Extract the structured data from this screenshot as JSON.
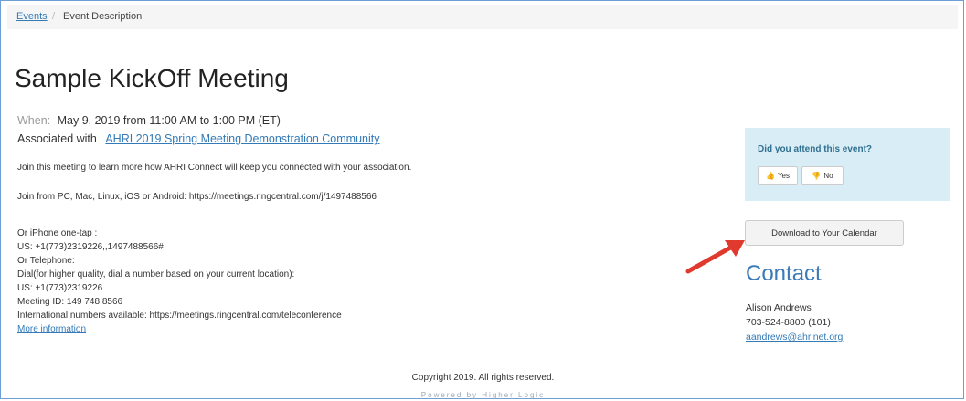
{
  "breadcrumb": {
    "link": "Events",
    "separator": "/",
    "current": "Event Description"
  },
  "event": {
    "title": "Sample KickOff Meeting",
    "when_label": "When:",
    "when_value": "May 9, 2019 from 11:00 AM to 1:00 PM (ET)",
    "assoc_label": "Associated with",
    "assoc_link": "AHRI 2019 Spring Meeting Demonstration Community",
    "description": [
      "Join this meeting to learn more how AHRI Connect will keep you connected with your association.",
      "Join from PC, Mac, Linux, iOS or Android: https://meetings.ringcentral.com/j/1497488566",
      "Or iPhone one-tap :",
      "US: +1(773)2319226,,1497488566#",
      "Or Telephone:",
      "Dial(for higher quality, dial a number based on your current location):",
      "US: +1(773)2319226",
      "Meeting ID: 149 748 8566",
      "International numbers available: https://meetings.ringcentral.com/teleconference"
    ],
    "more_link": "More information"
  },
  "attend": {
    "question": "Did you attend this event?",
    "yes_label": "Yes",
    "no_label": "No"
  },
  "calendar_button": "Download to Your Calendar",
  "contact": {
    "title": "Contact",
    "name": "Alison Andrews",
    "phone": "703-524-8800 (101)",
    "email": "aandrews@ahrinet.org"
  },
  "footer": {
    "copyright": "Copyright 2019. All rights reserved.",
    "powered": "Powered by Higher Logic"
  },
  "colors": {
    "link": "#337ab7",
    "attend_bg": "#d9edf7",
    "contact_heading": "#3a7ab8",
    "arrow": "#e03a2f"
  }
}
